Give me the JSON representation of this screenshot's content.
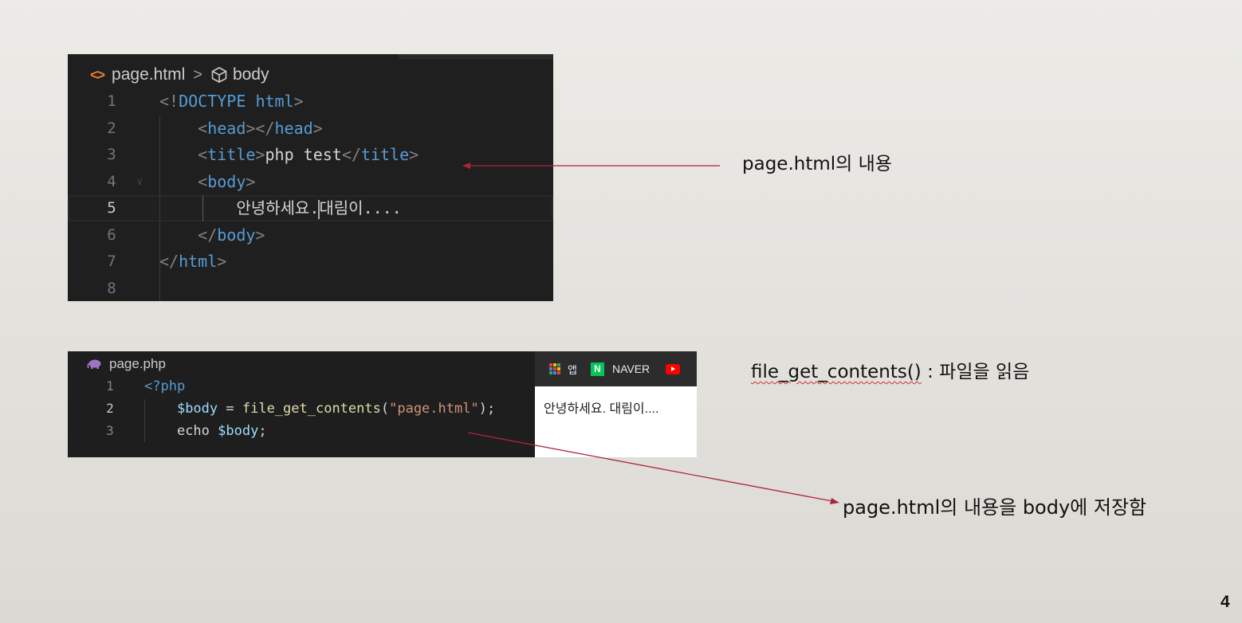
{
  "editor_html": {
    "breadcrumb": {
      "file": "page.html",
      "symbol": "body",
      "html_icon_glyph": "<>",
      "separator": ">"
    },
    "lines": [
      {
        "num": "1",
        "code": [
          [
            "pun",
            "<!"
          ],
          [
            "kw",
            "DOCTYPE"
          ],
          [
            "txt",
            " "
          ],
          [
            "kw",
            "html"
          ],
          [
            "pun",
            ">"
          ]
        ]
      },
      {
        "num": "2",
        "code": [
          [
            "txt",
            "    "
          ],
          [
            "pun",
            "<"
          ],
          [
            "tag",
            "head"
          ],
          [
            "pun",
            "></"
          ],
          [
            "tag",
            "head"
          ],
          [
            "pun",
            ">"
          ]
        ]
      },
      {
        "num": "3",
        "code": [
          [
            "txt",
            "    "
          ],
          [
            "pun",
            "<"
          ],
          [
            "tag",
            "title"
          ],
          [
            "pun",
            ">"
          ],
          [
            "txt",
            "php test"
          ],
          [
            "pun",
            "</"
          ],
          [
            "tag",
            "title"
          ],
          [
            "pun",
            ">"
          ]
        ]
      },
      {
        "num": "4",
        "code": [
          [
            "txt",
            "    "
          ],
          [
            "pun",
            "<"
          ],
          [
            "tag",
            "body"
          ],
          [
            "pun",
            ">"
          ]
        ]
      },
      {
        "num": "5",
        "code": [
          [
            "txt",
            "        안녕하세요."
          ],
          [
            "caret",
            ""
          ],
          [
            "txt",
            "대림이...."
          ]
        ]
      },
      {
        "num": "6",
        "code": [
          [
            "txt",
            "    "
          ],
          [
            "pun",
            "</"
          ],
          [
            "tag",
            "body"
          ],
          [
            "pun",
            ">"
          ]
        ]
      },
      {
        "num": "7",
        "code": [
          [
            "pun",
            "</"
          ],
          [
            "tag",
            "html"
          ],
          [
            "pun",
            ">"
          ]
        ]
      },
      {
        "num": "8",
        "code": []
      }
    ],
    "current_line": "5"
  },
  "editor_php": {
    "tab_title": "page.php",
    "lines": [
      {
        "num": "1",
        "code": [
          [
            "tag",
            "<?php"
          ]
        ]
      },
      {
        "num": "2",
        "code": [
          [
            "txt",
            "    "
          ],
          [
            "var",
            "$body"
          ],
          [
            "pun",
            " = "
          ],
          [
            "fn",
            "file_get_contents"
          ],
          [
            "pun",
            "("
          ],
          [
            "str",
            "\"page.html\""
          ],
          [
            "pun",
            ");"
          ]
        ]
      },
      {
        "num": "3",
        "code": [
          [
            "txt",
            "    "
          ],
          [
            "pun",
            "echo "
          ],
          [
            "var",
            "$body"
          ],
          [
            "pun",
            ";"
          ]
        ]
      }
    ],
    "current_line": "2"
  },
  "browser": {
    "bookmarks": {
      "apps_label": "앱",
      "naver_letter": "N",
      "naver_label": "NAVER"
    },
    "content": "안녕하세요. 대림이...."
  },
  "annotations": {
    "note1": "page.html의 내용",
    "note2_func": "file_get_contents()",
    "note2_rest": " : 파일을 읽음",
    "note3": "page.html의 내용을 body에 저장함"
  },
  "page_number": "4",
  "colors": {
    "arrow": "#b0243a",
    "editor_bg": "#1f1f1f",
    "tag": "#569cd6",
    "string": "#ce9178",
    "function": "#dcdcaa",
    "variable": "#9cdcfe"
  }
}
